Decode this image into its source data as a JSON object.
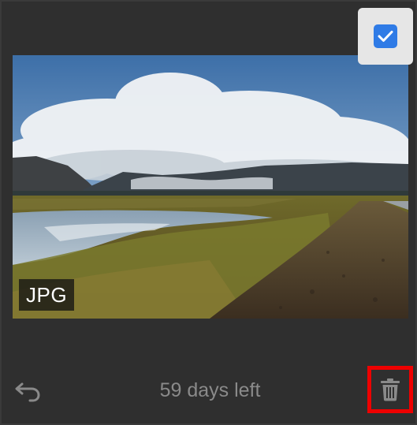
{
  "photo": {
    "format_label": "JPG",
    "selected": true
  },
  "footer": {
    "days_left_label": "59 days left"
  },
  "colors": {
    "background": "#2f2f2f",
    "checkbox_accent": "#2f7be6",
    "delete_highlight": "#ee0000",
    "muted_text": "#8a8a8a"
  },
  "icons": {
    "select": "checkmark-icon",
    "restore": "undo-arrow-icon",
    "delete": "trash-icon"
  }
}
